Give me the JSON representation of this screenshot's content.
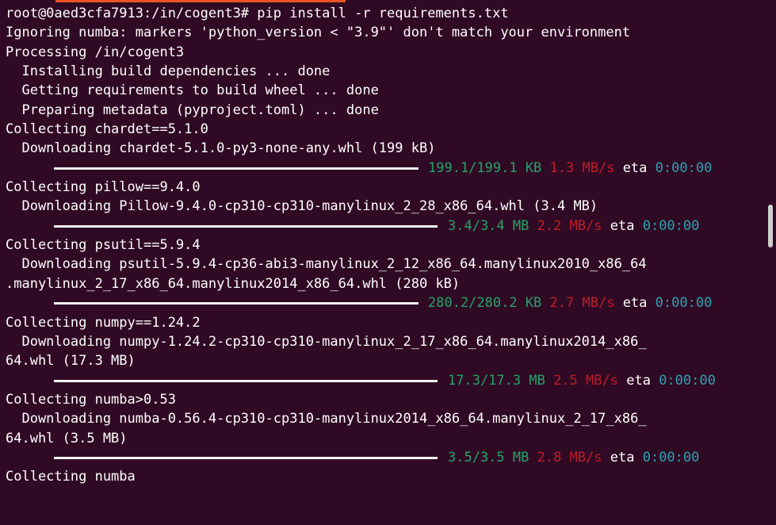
{
  "terminal": {
    "lines": {
      "l1": "root@0aed3cfa7913:/in/cogent3# pip install -r requirements.txt",
      "l2": "Ignoring numba: markers 'python_version < \"3.9\"' don't match your environment",
      "l3": "Processing /in/cogent3",
      "l4": "  Installing build dependencies ... done",
      "l5": "  Getting requirements to build wheel ... done",
      "l6": "  Preparing metadata (pyproject.toml) ... done",
      "l7": "Collecting chardet==5.1.0",
      "l8": "  Downloading chardet-5.1.0-py3-none-any.whl (199 kB)",
      "l10": "Collecting pillow==9.4.0",
      "l11": "  Downloading Pillow-9.4.0-cp310-cp310-manylinux_2_28_x86_64.whl (3.4 MB)",
      "l13": "Collecting psutil==5.9.4",
      "l14": "  Downloading psutil-5.9.4-cp36-abi3-manylinux_2_12_x86_64.manylinux2010_x86_64",
      "l15": ".manylinux_2_17_x86_64.manylinux2014_x86_64.whl (280 kB)",
      "l17": "Collecting numpy==1.24.2",
      "l18": "  Downloading numpy-1.24.2-cp310-cp310-manylinux_2_17_x86_64.manylinux2014_x86_",
      "l19": "64.whl (17.3 MB)",
      "l21": "Collecting numba>0.53",
      "l22": "  Downloading numba-0.56.4-cp310-cp310-manylinux2014_x86_64.manylinux_2_17_x86_",
      "l23": "64.whl (3.5 MB)",
      "l25": "Collecting numba"
    },
    "progress": [
      {
        "size": "199.1/199.1 KB",
        "speed": "1.3 MB/s",
        "eta_label": "eta",
        "eta": "0:00:00",
        "fraction": 1.0
      },
      {
        "size": "3.4/3.4 MB",
        "speed": "2.2 MB/s",
        "eta_label": "eta",
        "eta": "0:00:00",
        "fraction": 1.0
      },
      {
        "size": "280.2/280.2 KB",
        "speed": "2.7 MB/s",
        "eta_label": "eta",
        "eta": "0:00:00",
        "fraction": 1.0
      },
      {
        "size": "17.3/17.3 MB",
        "speed": "2.5 MB/s",
        "eta_label": "eta",
        "eta": "0:00:00",
        "fraction": 1.0
      },
      {
        "size": "3.5/3.5 MB",
        "speed": "2.8 MB/s",
        "eta_label": "eta",
        "eta": "0:00:00",
        "fraction": 1.0
      }
    ]
  },
  "colors": {
    "background": "#300a24",
    "tab_accent": "#e95420",
    "size_green": "#26a269",
    "speed_red": "#c01c28",
    "eta_cyan": "#2aa1b3"
  }
}
